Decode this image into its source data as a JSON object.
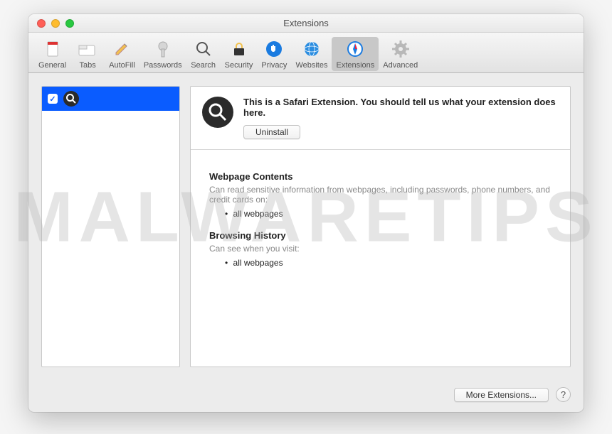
{
  "window": {
    "title": "Extensions"
  },
  "toolbar": {
    "items": [
      {
        "label": "General"
      },
      {
        "label": "Tabs"
      },
      {
        "label": "AutoFill"
      },
      {
        "label": "Passwords"
      },
      {
        "label": "Search"
      },
      {
        "label": "Security"
      },
      {
        "label": "Privacy"
      },
      {
        "label": "Websites"
      },
      {
        "label": "Extensions"
      },
      {
        "label": "Advanced"
      }
    ]
  },
  "sidebar": {
    "checkbox_checked": true
  },
  "details": {
    "description": "This is a Safari Extension. You should tell us what your extension does here.",
    "uninstall_label": "Uninstall",
    "sections": [
      {
        "title": "Webpage Contents",
        "subtitle": "Can read sensitive information from webpages, including passwords, phone numbers, and credit cards on:",
        "bullet": "all webpages"
      },
      {
        "title": "Browsing History",
        "subtitle": "Can see when you visit:",
        "bullet": "all webpages"
      }
    ]
  },
  "footer": {
    "more_label": "More Extensions...",
    "help_label": "?"
  },
  "watermark": "MALWARETIPS"
}
